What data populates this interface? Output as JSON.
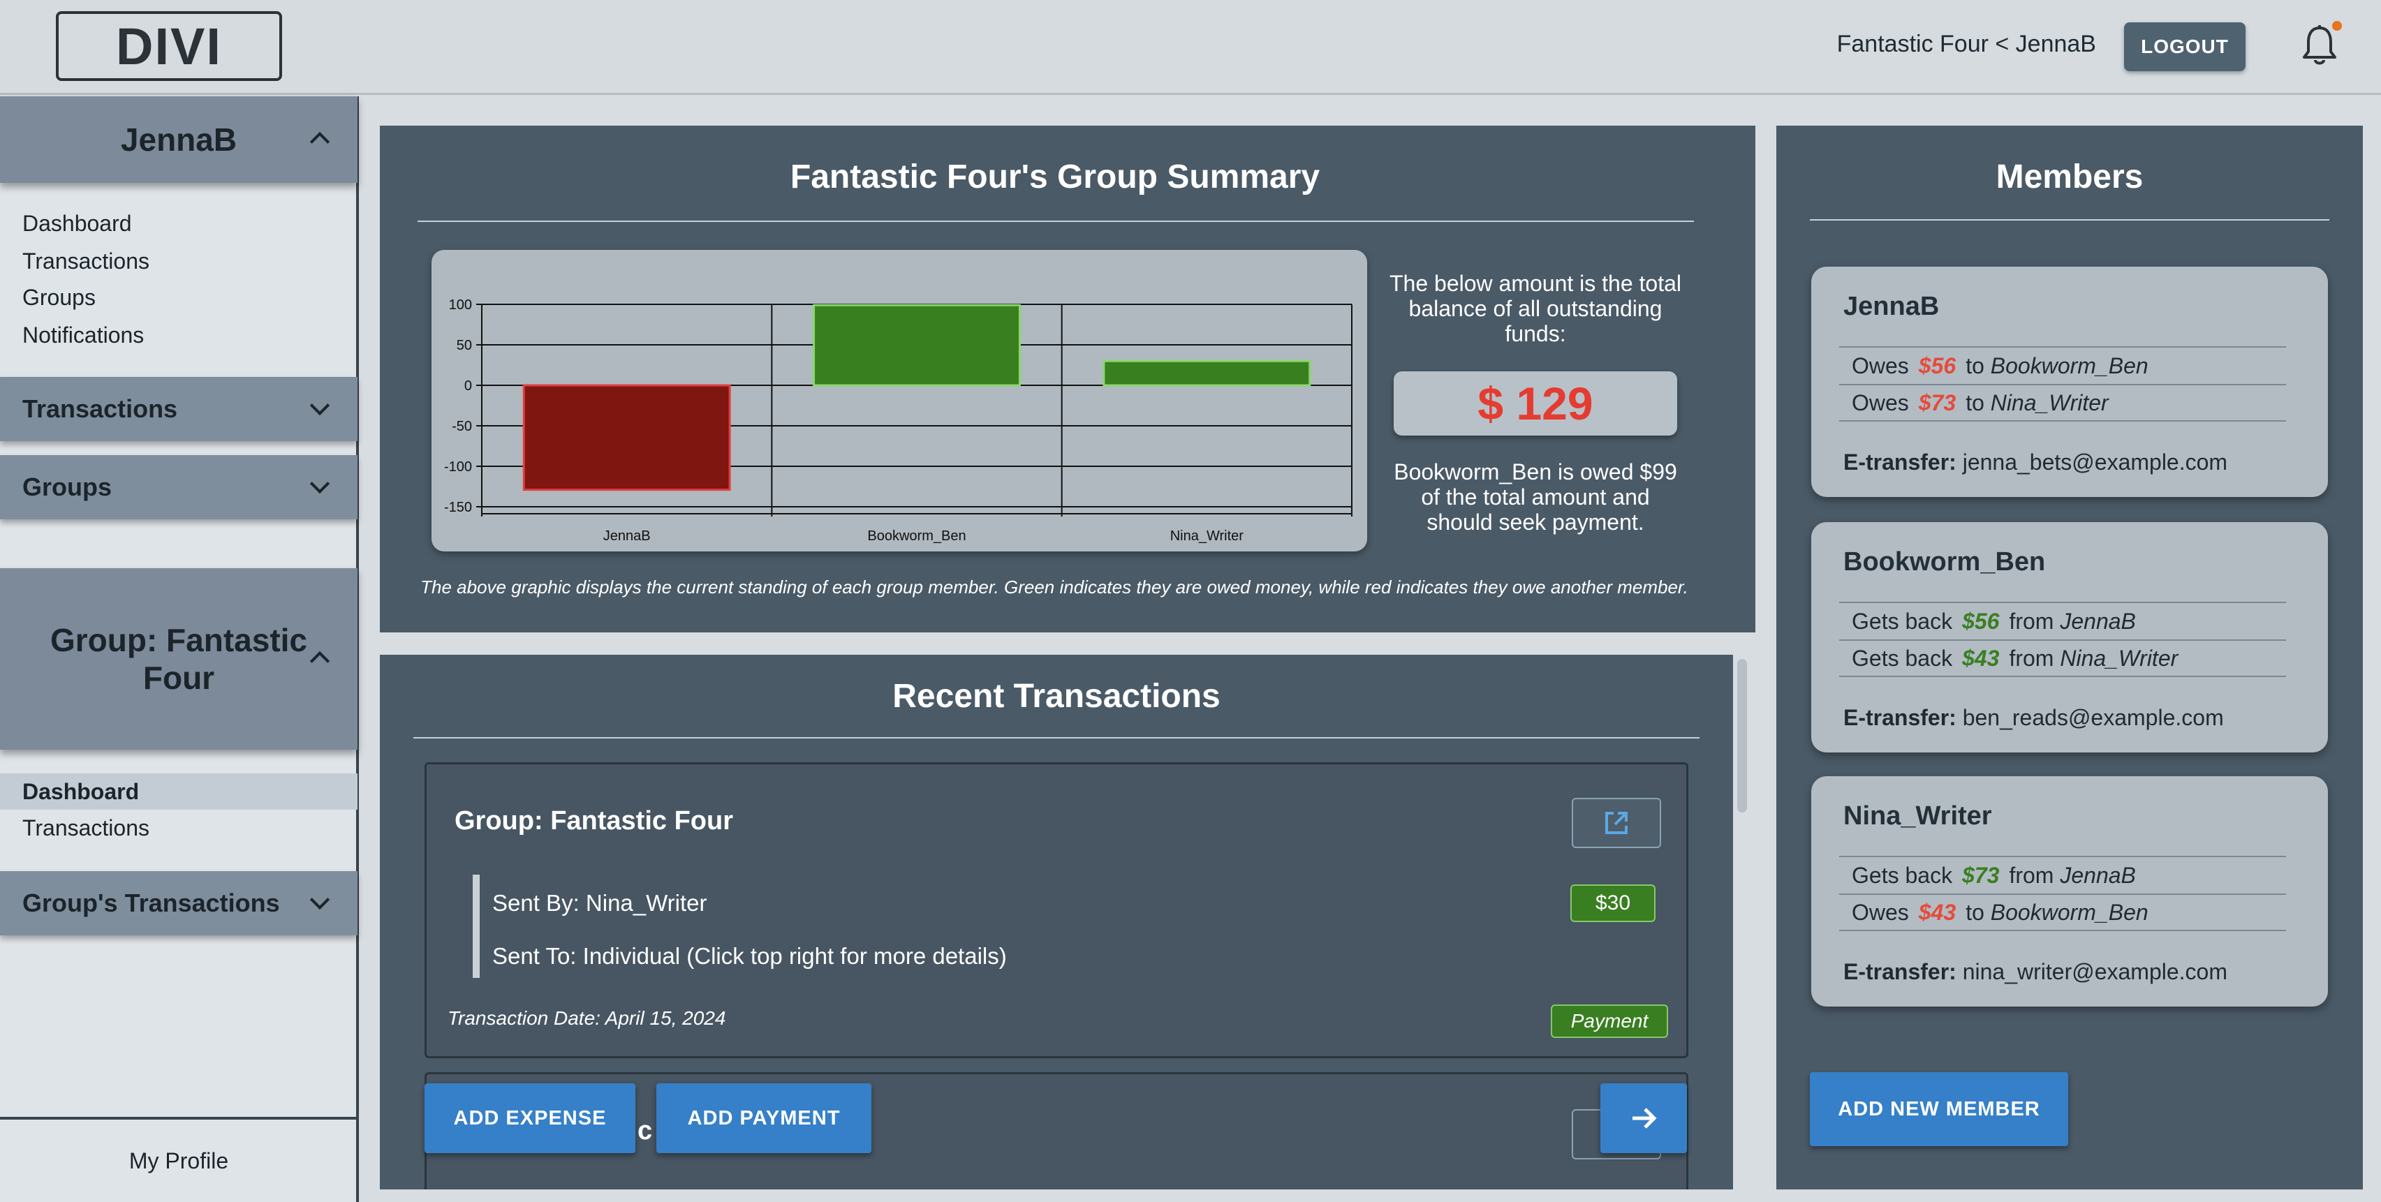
{
  "header": {
    "logo": "DIVI",
    "user_path": "Fantastic Four < JennaB",
    "logout": "LOGOUT"
  },
  "sidebar": {
    "user_section": "JennaB",
    "user_links": [
      "Dashboard",
      "Transactions",
      "Groups",
      "Notifications"
    ],
    "transactions_section": "Transactions",
    "groups_section": "Groups",
    "group_section": "Group: Fantastic Four",
    "group_links": [
      "Dashboard",
      "Transactions"
    ],
    "group_tx_section": "Group's Transactions",
    "profile": "My Profile"
  },
  "summary": {
    "title": "Fantastic Four's Group Summary",
    "balance_note": "The below amount is the total balance of all outstanding funds:",
    "balance": "$ 129",
    "owed_note": "Bookworm_Ben is owed $99 of the total amount and should seek payment.",
    "caption": "The above graphic displays the current standing of each group member. Green indicates they are owed money, while red indicates they owe another member."
  },
  "chart_data": {
    "type": "bar",
    "categories": [
      "JennaB",
      "Bookworm_Ben",
      "Nina_Writer"
    ],
    "values": [
      -129,
      99,
      30
    ],
    "ylim": [
      -150,
      100
    ],
    "yticks": [
      100,
      50,
      0,
      -50,
      -100,
      -150
    ],
    "grid": true,
    "colors": {
      "positive": "#38801f",
      "negative": "#7f1610",
      "positive_border": "#8ad66a",
      "negative_border": "#e04040"
    }
  },
  "transactions": {
    "title": "Recent Transactions",
    "items": [
      {
        "group": "Group: Fantastic Four",
        "sent_by": "Sent By: Nina_Writer",
        "sent_to": "Sent To: Individual (Click top right for more details)",
        "amount": "$30",
        "date": "Transaction Date: April 15, 2024",
        "type": "Payment"
      }
    ],
    "second_partial": "c",
    "add_expense": "ADD EXPENSE",
    "add_payment": "ADD PAYMENT"
  },
  "members": {
    "title": "Members",
    "list": [
      {
        "name": "JennaB",
        "rows": [
          {
            "verb": "Owes",
            "amount": "$56",
            "prep": "to",
            "who": "Bookworm_Ben",
            "color": "red"
          },
          {
            "verb": "Owes",
            "amount": "$73",
            "prep": "to",
            "who": "Nina_Writer",
            "color": "red"
          }
        ],
        "etransfer_label": "E-transfer:",
        "email": "jenna_bets@example.com"
      },
      {
        "name": "Bookworm_Ben",
        "rows": [
          {
            "verb": "Gets back",
            "amount": "$56",
            "prep": "from",
            "who": "JennaB",
            "color": "green"
          },
          {
            "verb": "Gets back",
            "amount": "$43",
            "prep": "from",
            "who": "Nina_Writer",
            "color": "green"
          }
        ],
        "etransfer_label": "E-transfer:",
        "email": "ben_reads@example.com"
      },
      {
        "name": "Nina_Writer",
        "rows": [
          {
            "verb": "Gets back",
            "amount": "$73",
            "prep": "from",
            "who": "JennaB",
            "color": "green"
          },
          {
            "verb": "Owes",
            "amount": "$43",
            "prep": "to",
            "who": "Bookworm_Ben",
            "color": "red"
          }
        ],
        "etransfer_label": "E-transfer:",
        "email": "nina_writer@example.com"
      }
    ],
    "add_member": "ADD NEW MEMBER"
  },
  "icons": {
    "bell": "bell-icon",
    "open": "external-link-icon",
    "next": "arrow-right-icon"
  }
}
